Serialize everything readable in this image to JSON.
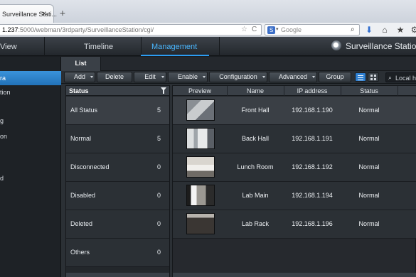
{
  "browser": {
    "tab_title": "Surveillance Stati...",
    "url_host": "1.237",
    "url_rest": ":5000/webman/3rdparty/SurveillanceStation/cgi/",
    "search_placeholder": "Google"
  },
  "appbar": {
    "view": "View",
    "timeline": "Timeline",
    "management": "Management",
    "brand": "Surveillance Statio"
  },
  "sidebar": {
    "items": [
      {
        "label": "ra",
        "active": true
      },
      {
        "label": "tion",
        "active": false
      },
      {
        "label": "g",
        "active": false
      },
      {
        "label": "on",
        "active": false
      },
      {
        "label": "d",
        "active": false
      }
    ]
  },
  "subtabs": {
    "list": "List"
  },
  "toolbar": {
    "add": "Add",
    "delete": "Delete",
    "edit": "Edit",
    "enable": "Enable",
    "configuration": "Configuration",
    "advanced": "Advanced",
    "group": "Group",
    "local_search": "Local h"
  },
  "status_panel": {
    "header": "Status",
    "rows": [
      {
        "label": "All Status",
        "count": "5"
      },
      {
        "label": "Normal",
        "count": "5"
      },
      {
        "label": "Disconnected",
        "count": "0"
      },
      {
        "label": "Disabled",
        "count": "0"
      },
      {
        "label": "Deleted",
        "count": "0"
      },
      {
        "label": "Others",
        "count": "0"
      }
    ]
  },
  "camera_table": {
    "headers": {
      "preview": "Preview",
      "name": "Name",
      "ip": "IP address",
      "status": "Status"
    },
    "rows": [
      {
        "name": "Front Hall",
        "ip": "192.168.1.190",
        "status": "Normal"
      },
      {
        "name": "Back Hall",
        "ip": "192.168.1.191",
        "status": "Normal"
      },
      {
        "name": "Lunch Room",
        "ip": "192.168.1.192",
        "status": "Normal"
      },
      {
        "name": "Lab Main",
        "ip": "192.168.1.194",
        "status": "Normal"
      },
      {
        "name": "Lab Rack",
        "ip": "192.168.1.196",
        "status": "Normal"
      }
    ]
  },
  "colors": {
    "accent": "#2c9df2",
    "active_sidebar": "#2b82c9"
  }
}
